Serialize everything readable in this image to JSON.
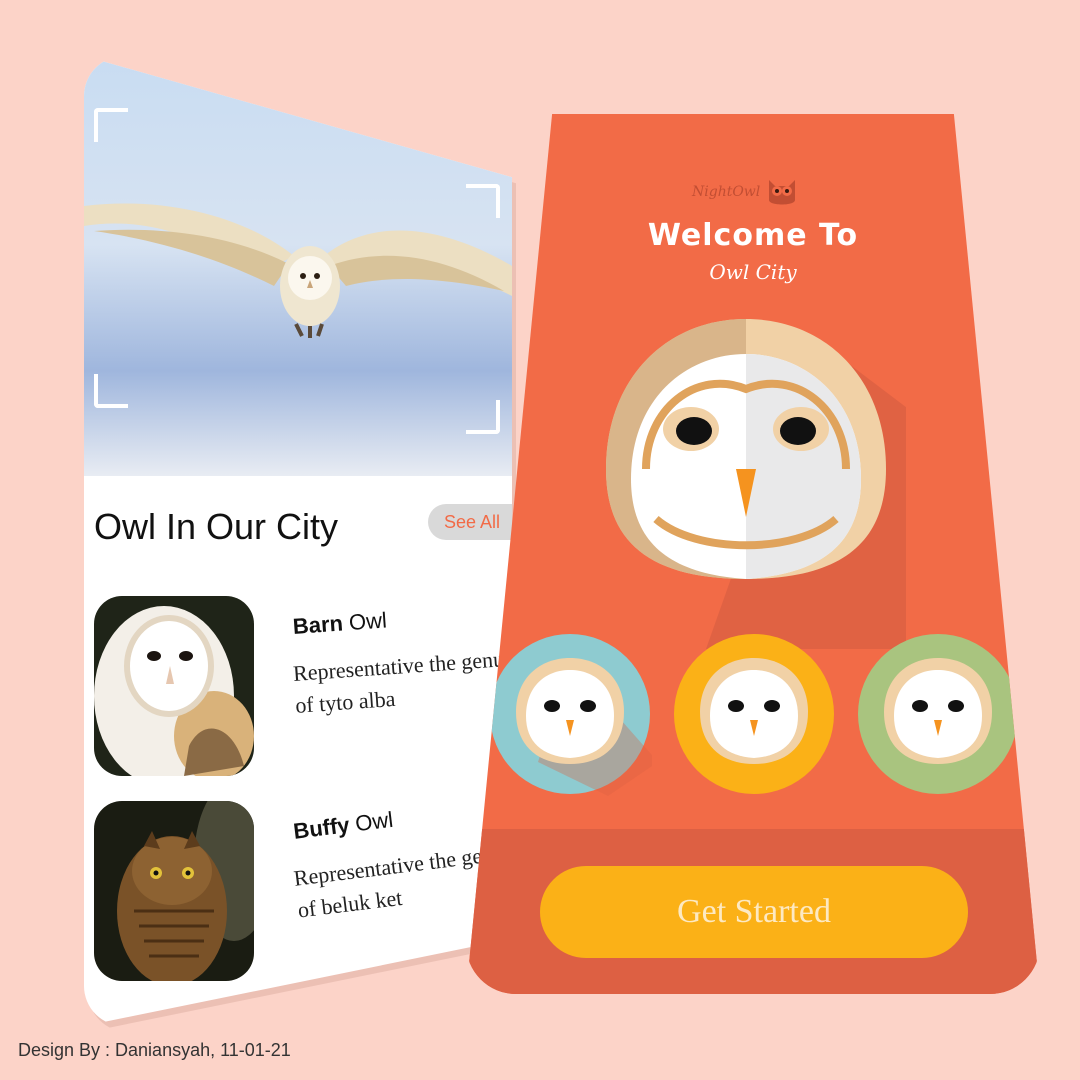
{
  "left_card": {
    "section_title": "Owl In Our City",
    "see_all_label": "See All",
    "owls": [
      {
        "name_bold": "Barn",
        "name_rest": " Owl",
        "description": "Representative the genus of tyto alba"
      },
      {
        "name_bold": "Buffy",
        "name_rest": " Owl",
        "description": "Representative the genus of beluk ket"
      }
    ]
  },
  "right_card": {
    "brand": "NightOwl",
    "welcome_title": "Welcome To",
    "welcome_subtitle": "Owl City",
    "get_started_label": "Get Started",
    "avatar_colors": [
      "#8ecbd0",
      "#fbb117",
      "#a9c47f"
    ]
  },
  "footer": {
    "credit": "Design By : Daniansyah, 11-01-21"
  },
  "colors": {
    "background": "#fcd3c8",
    "accent": "#f26b47",
    "button": "#fbb117"
  }
}
